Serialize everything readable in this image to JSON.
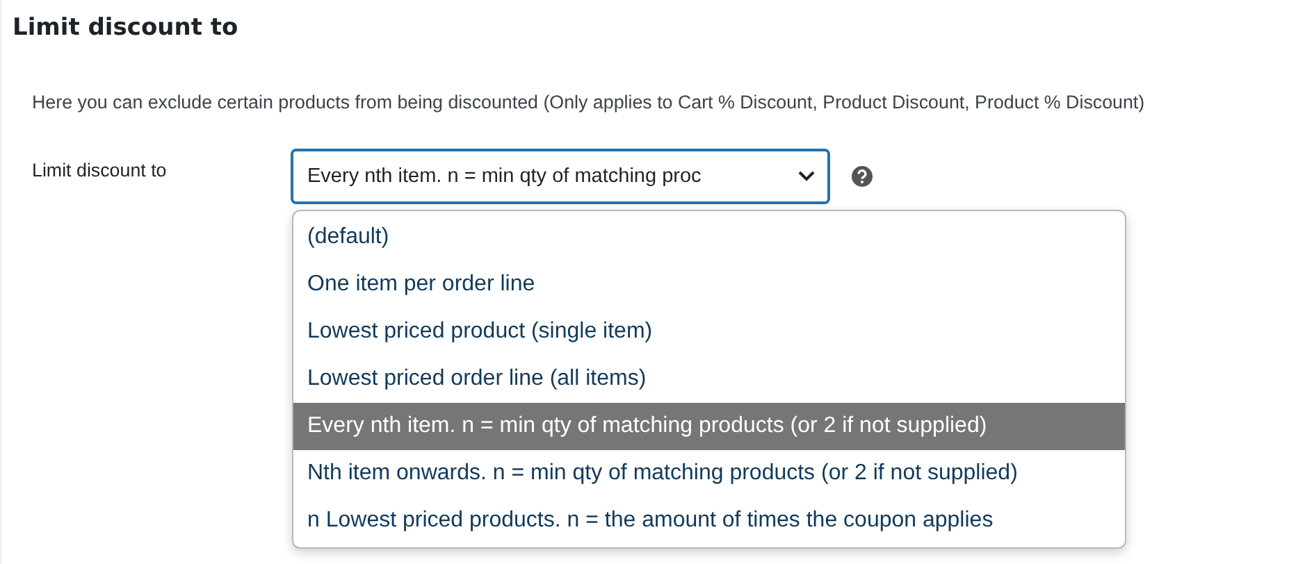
{
  "heading": "Limit discount to",
  "description": "Here you can exclude certain products from being discounted (Only applies to Cart % Discount, Product Discount, Product % Discount)",
  "field": {
    "label": "Limit discount to",
    "value": "Every nth item. n = min qty of matching proc",
    "open": true,
    "options": [
      {
        "label": "(default)",
        "selected": false
      },
      {
        "label": "One item per order line",
        "selected": false
      },
      {
        "label": "Lowest priced product (single item)",
        "selected": false
      },
      {
        "label": "Lowest priced order line (all items)",
        "selected": false
      },
      {
        "label": "Every nth item. n = min qty of matching products (or 2 if not supplied)",
        "selected": true
      },
      {
        "label": "Nth item onwards. n = min qty of matching products (or 2 if not supplied)",
        "selected": false
      },
      {
        "label": "n Lowest priced products. n = the amount of times the coupon applies",
        "selected": false
      }
    ]
  }
}
